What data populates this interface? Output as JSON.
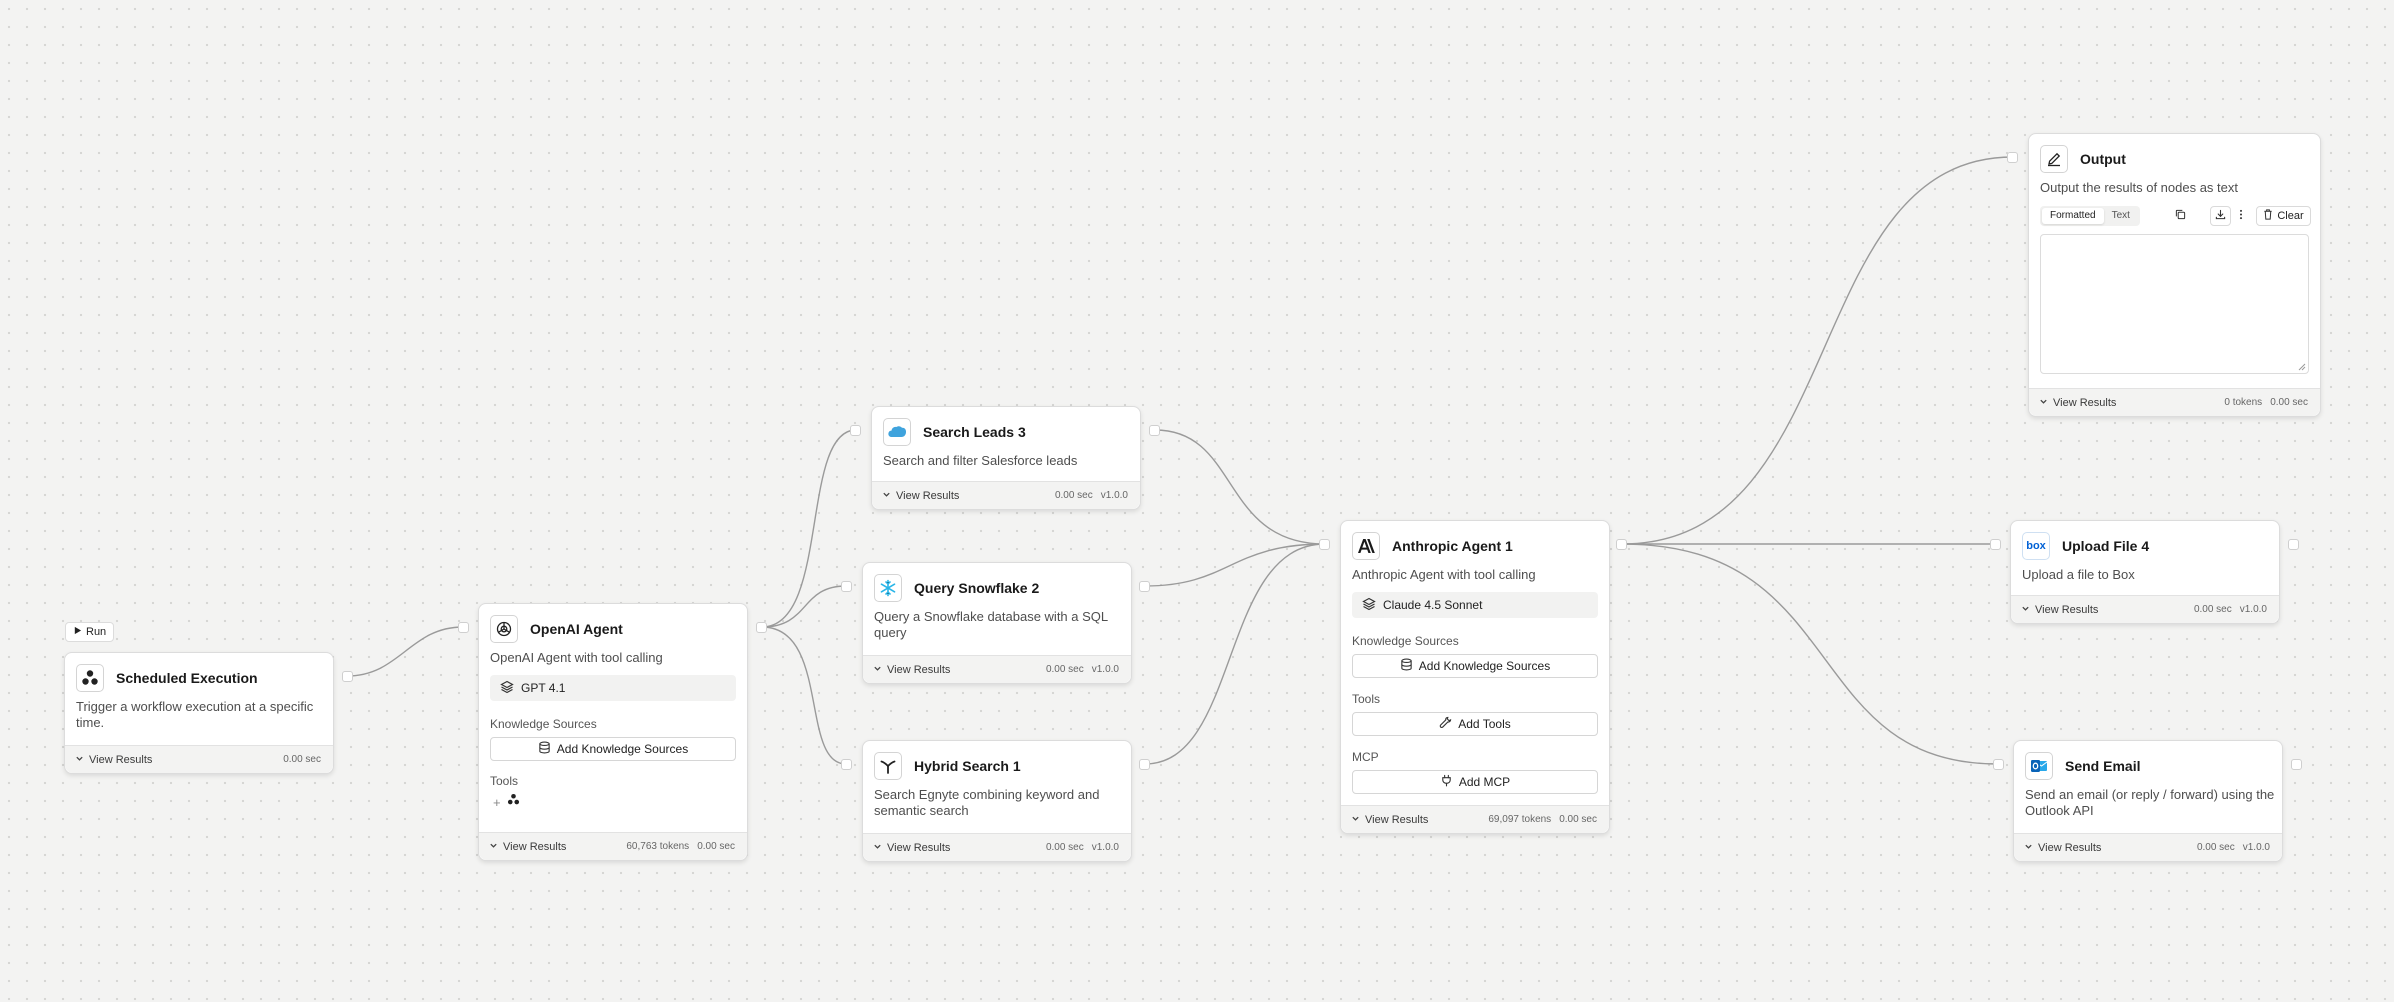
{
  "canvas": {
    "run_label": "Run",
    "view_results_label": "View Results",
    "icons": [
      "chevron-down-icon",
      "play-icon",
      "layers-icon",
      "database-icon",
      "wrench-icon",
      "plug-icon"
    ]
  },
  "nodes": {
    "scheduled": {
      "title": "Scheduled Execution",
      "desc": "Trigger a workflow execution at a specific time.",
      "time": "0.00 sec",
      "icon": "scheduled-icon"
    },
    "openai": {
      "title": "OpenAI Agent",
      "desc": "OpenAI Agent with tool calling",
      "model": "GPT 4.1",
      "knowledge_label": "Knowledge Sources",
      "add_knowledge": "Add Knowledge Sources",
      "tools_label": "Tools",
      "tokens": "60,763 tokens",
      "time": "0.00 sec",
      "icon": "openai-icon"
    },
    "search_leads": {
      "title": "Search Leads 3",
      "desc": "Search and filter Salesforce leads",
      "time": "0.00 sec",
      "version": "v1.0.0",
      "icon": "salesforce-icon"
    },
    "snowflake": {
      "title": "Query Snowflake 2",
      "desc": "Query a Snowflake database with a SQL query",
      "time": "0.00 sec",
      "version": "v1.0.0",
      "icon": "snowflake-icon"
    },
    "hybrid": {
      "title": "Hybrid Search 1",
      "desc": "Search Egnyte combining keyword and semantic search",
      "time": "0.00 sec",
      "version": "v1.0.0",
      "icon": "egnyte-icon"
    },
    "anthropic": {
      "title": "Anthropic Agent 1",
      "desc": "Anthropic Agent with tool calling",
      "model": "Claude 4.5 Sonnet",
      "knowledge_label": "Knowledge Sources",
      "add_knowledge": "Add Knowledge Sources",
      "tools_label": "Tools",
      "add_tools": "Add Tools",
      "mcp_label": "MCP",
      "add_mcp": "Add MCP",
      "tokens": "69,097 tokens",
      "time": "0.00 sec",
      "icon": "anthropic-icon"
    },
    "output": {
      "title": "Output",
      "desc": "Output the results of nodes as text",
      "tab_formatted": "Formatted",
      "tab_text": "Text",
      "clear_label": "Clear",
      "tokens": "0 tokens",
      "time": "0.00 sec",
      "icon": "pencil-icon"
    },
    "upload": {
      "title": "Upload File 4",
      "desc": "Upload a file to Box",
      "time": "0.00 sec",
      "version": "v1.0.0",
      "icon": "box-icon",
      "logo_text": "box"
    },
    "email": {
      "title": "Send Email",
      "desc": "Send an email (or reply / forward) using the Outlook API",
      "time": "0.00 sec",
      "version": "v1.0.0",
      "icon": "outlook-icon"
    }
  }
}
